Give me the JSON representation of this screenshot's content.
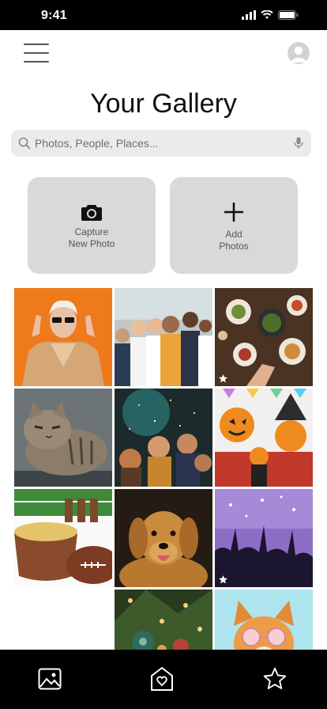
{
  "status_bar": {
    "time": "9:41"
  },
  "header": {
    "title": "Your Gallery"
  },
  "search": {
    "placeholder": "Photos, People, Places..."
  },
  "actions": {
    "capture": {
      "line1": "Capture",
      "line2": "New Photo"
    },
    "add": {
      "line1": "Add",
      "line2": "Photos"
    }
  },
  "photos": [
    {
      "subject": "woman-sunglasses-rock-hands",
      "favorite": false
    },
    {
      "subject": "group-of-friends",
      "favorite": false
    },
    {
      "subject": "dinner-table-overhead",
      "favorite": true
    },
    {
      "subject": "tabby-cat",
      "favorite": false
    },
    {
      "subject": "party-crowd-confetti",
      "favorite": false
    },
    {
      "subject": "halloween-pumpkin-masks",
      "favorite": false
    },
    {
      "subject": "football-snacks",
      "favorite": false
    },
    {
      "subject": "golden-retriever",
      "favorite": false
    },
    {
      "subject": "concert-crowd",
      "favorite": true
    },
    {
      "subject": "christmas-tree-ornaments",
      "favorite": false
    },
    {
      "subject": "cat-with-sunglasses",
      "favorite": false
    }
  ],
  "colors": {
    "background": "#ffffff",
    "card": "#d9d9d9",
    "search_bg": "#ebebeb",
    "bars": "#000000"
  },
  "tab_bar": {
    "icons": [
      "gallery-icon",
      "home-heart-icon",
      "star-icon"
    ]
  }
}
